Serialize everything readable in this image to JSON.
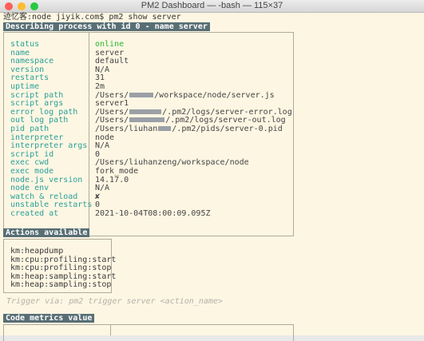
{
  "window": {
    "title": "PM2 Dashboard — -bash — 115×37",
    "lights": [
      {
        "name": "close",
        "color": "#fe5f57"
      },
      {
        "name": "minimize",
        "color": "#febc2e"
      },
      {
        "name": "zoom",
        "color": "#28c840"
      }
    ]
  },
  "terminal": {
    "prompt": "迹忆客:node jiyik.com$ pm2 show server",
    "describe_header": "Describing process with id 0 - name server",
    "info_rows": [
      {
        "key": "status",
        "value": "online",
        "status": true
      },
      {
        "key": "name",
        "value": "server"
      },
      {
        "key": "namespace",
        "value": "default"
      },
      {
        "key": "version",
        "value": "N/A"
      },
      {
        "key": "restarts",
        "value": "31"
      },
      {
        "key": "uptime",
        "value": "2m"
      },
      {
        "key": "script path",
        "pre": "/Users/",
        "post": "/workspace/node/server.js",
        "redact": [
          30
        ]
      },
      {
        "key": "script args",
        "value": "server1"
      },
      {
        "key": "error log path",
        "pre": "/Users/",
        "post": "/.pm2/logs/server-error.log",
        "redact": [
          40
        ]
      },
      {
        "key": "out log path",
        "pre": "/Users/",
        "post": "/.pm2/logs/server-out.log",
        "redact": [
          44
        ]
      },
      {
        "key": "pid path",
        "pre": "/Users/liuhan",
        "post": "/.pm2/pids/server-0.pid",
        "redact": [
          16
        ]
      },
      {
        "key": "interpreter",
        "value": "node"
      },
      {
        "key": "interpreter args",
        "value": "N/A"
      },
      {
        "key": "script id",
        "value": "0"
      },
      {
        "key": "exec cwd",
        "value": "/Users/liuhanzeng/workspace/node"
      },
      {
        "key": "exec mode",
        "value": "fork_mode"
      },
      {
        "key": "node.js version",
        "value": "14.17.0"
      },
      {
        "key": "node env",
        "value": "N/A"
      },
      {
        "key": "watch & reload",
        "value": "✘"
      },
      {
        "key": "unstable restarts",
        "value": "0"
      },
      {
        "key": "created at",
        "value": "2021-10-04T08:00:09.095Z"
      }
    ],
    "actions_header": "Actions available",
    "actions": [
      "km:heapdump",
      "km:cpu:profiling:start",
      "km:cpu:profiling:stop",
      "km:heap:sampling:start",
      "km:heap:sampling:stop"
    ],
    "trigger_hint": "Trigger via: pm2 trigger server <action_name>",
    "metrics_header": "Code metrics value"
  }
}
